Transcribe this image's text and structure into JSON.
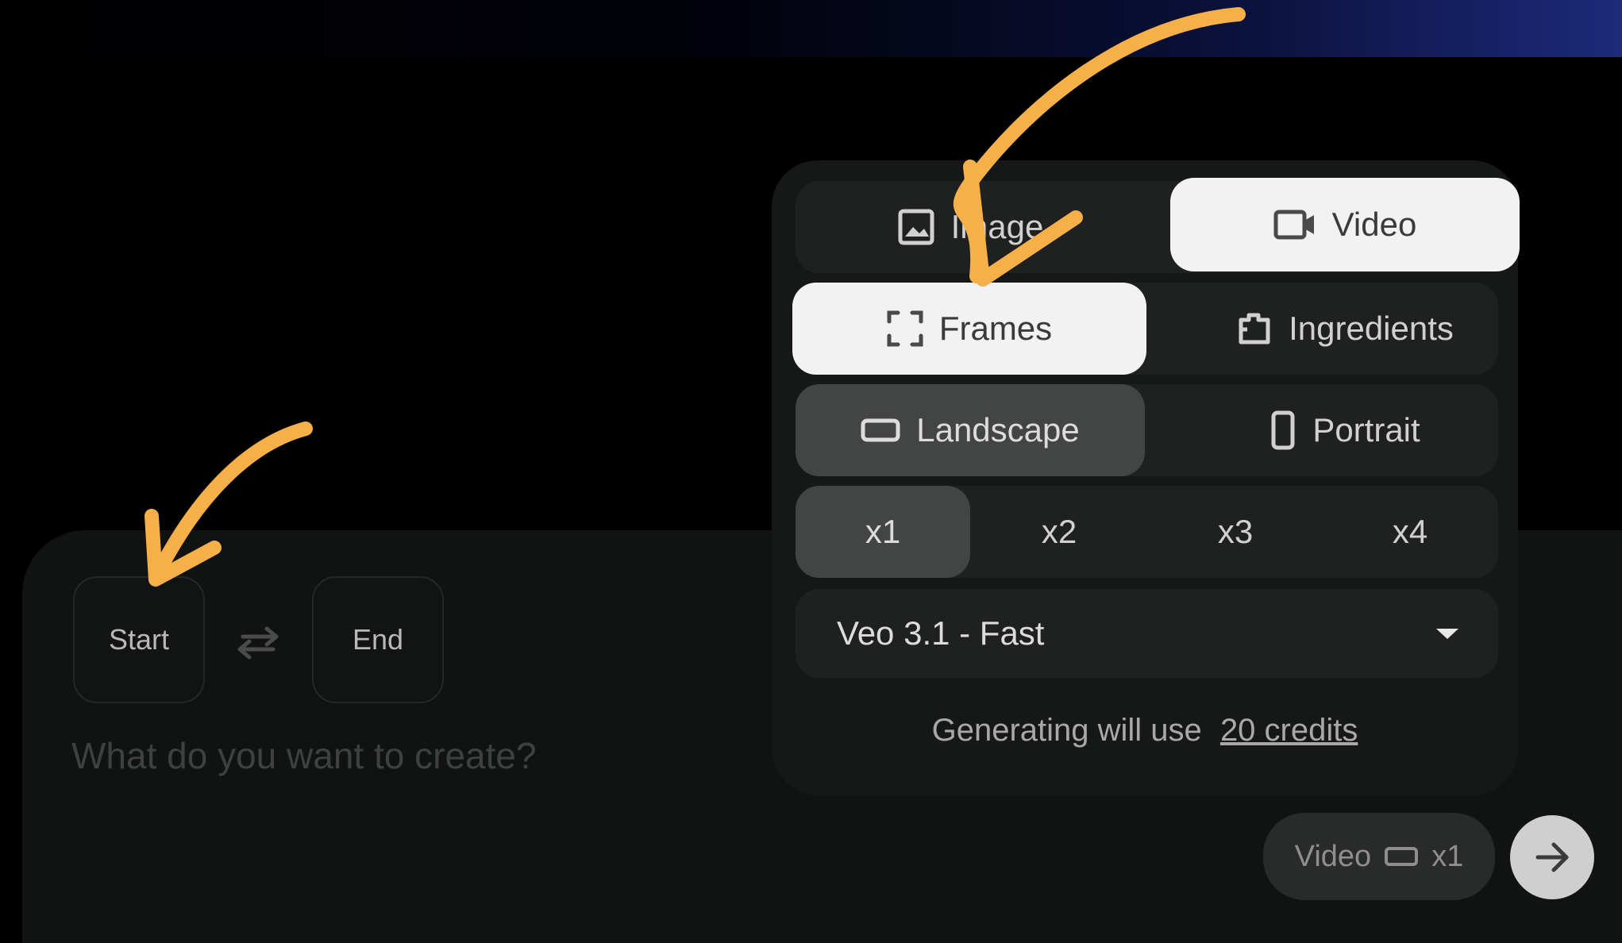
{
  "composer": {
    "start_label": "Start",
    "end_label": "End",
    "prompt_placeholder": "What do you want to create?"
  },
  "settings": {
    "media_type": {
      "options": [
        {
          "label": "Image",
          "icon": "image-icon"
        },
        {
          "label": "Video",
          "icon": "video-icon"
        }
      ],
      "selected": "Video"
    },
    "video_mode": {
      "options": [
        {
          "label": "Frames",
          "icon": "frames-icon"
        },
        {
          "label": "Ingredients",
          "icon": "ingredients-icon"
        }
      ],
      "selected": "Frames"
    },
    "orientation": {
      "options": [
        {
          "label": "Landscape",
          "icon": "landscape-icon"
        },
        {
          "label": "Portrait",
          "icon": "portrait-icon"
        }
      ],
      "selected": "Landscape"
    },
    "count": {
      "options": [
        "x1",
        "x2",
        "x3",
        "x4"
      ],
      "selected": "x1"
    },
    "model": {
      "value": "Veo 3.1 - Fast"
    },
    "credits": {
      "prefix": "Generating will use",
      "link": "20 credits"
    }
  },
  "summary_chip": {
    "type": "Video",
    "count": "x1"
  },
  "colors": {
    "annotation_arrow": "#f5b04a",
    "active_white": "#f2f2f2",
    "active_grey": "#434545"
  }
}
